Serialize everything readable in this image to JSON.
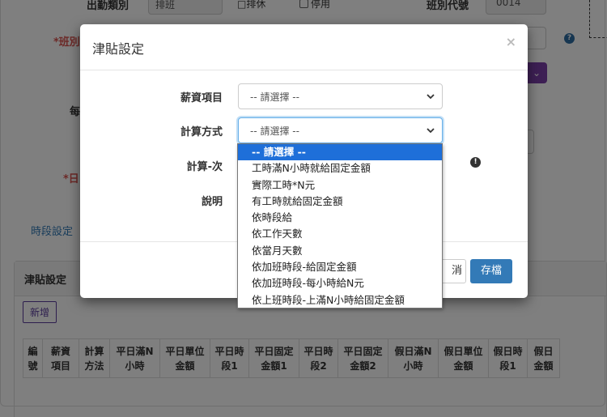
{
  "background": {
    "top_labels": {
      "work_category": "出勤類別",
      "work_category_value": "排班",
      "overtime_check": "□排休",
      "disable_check": "停用",
      "shift_code_label": "班別代號",
      "shift_code_value": "0014"
    },
    "left_labels": {
      "shift_name": "*班別",
      "every": "每",
      "date": "*日"
    },
    "tab_time_setting": "時段設定",
    "allowance_section_title": "津貼設定",
    "add_button": "新增",
    "table_headers": [
      "編\n號",
      "薪資\n項目",
      "計算\n方法",
      "平日滿N\n小時",
      "平日單位\n金額",
      "平日時\n段1",
      "平日固定\n金額1",
      "平日時\n段2",
      "平日固定\n金額2",
      "假日滿N\n小時",
      "假日單位\n金額",
      "假日時\n段1",
      "假日\n金額"
    ]
  },
  "modal": {
    "title": "津貼設定",
    "close_symbol": "×",
    "fields": {
      "salary_item_label": "薪資項目",
      "salary_item_value": "-- 請選擇 --",
      "calc_method_label": "計算方式",
      "calc_method_value": "-- 請選擇 --",
      "calc_count_label": "計算-次",
      "description_label": "說明"
    },
    "buttons": {
      "cancel": "消",
      "save": "存檔"
    }
  },
  "dropdown": {
    "options": [
      "-- 請選擇 --",
      "工時滿N小時就給固定金額",
      "實際工時*N元",
      "有工時就給固定金額",
      "依時段給",
      "依工作天數",
      "依當月天數",
      "依加班時段-給固定金額",
      "依加班時段-每小時給N元",
      "依上班時段-上滿N小時給固定金額"
    ],
    "selected_index": 0
  },
  "colors": {
    "primary": "#337ab7",
    "selected_option": "#1e6fd9",
    "required": "#d9534f",
    "purple": "#7b3fa8"
  }
}
